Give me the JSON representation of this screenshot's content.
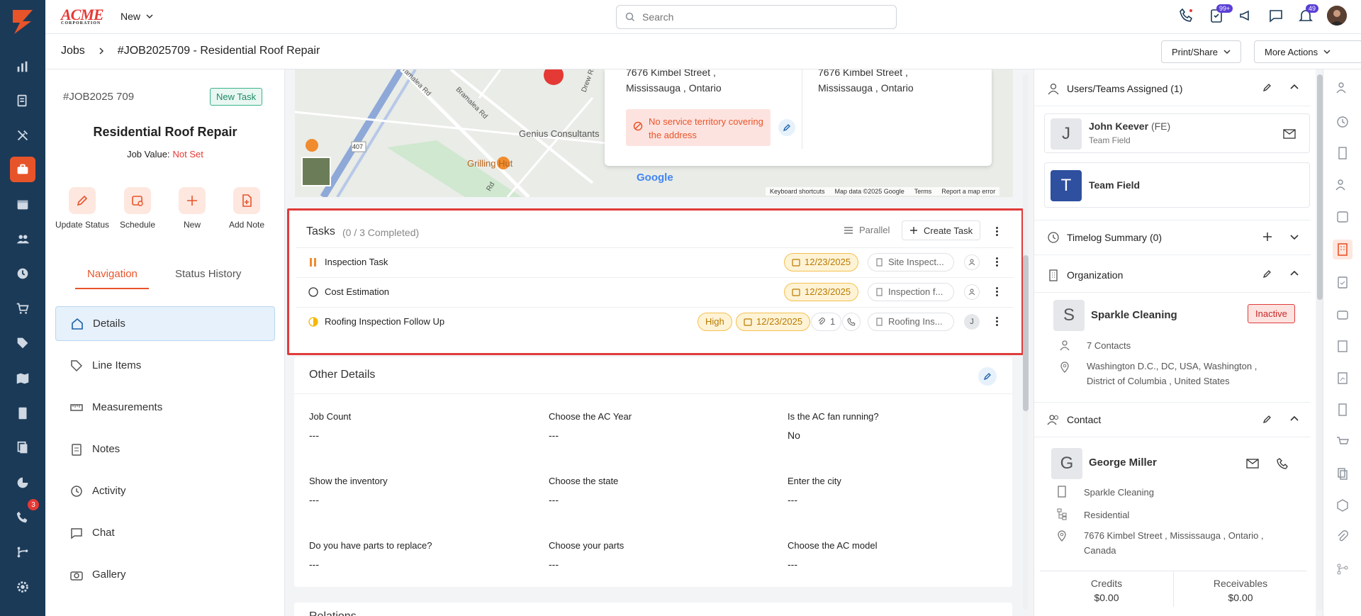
{
  "brand": {
    "name": "ACME",
    "sub": "CORPORATION"
  },
  "topbar": {
    "new_label": "New",
    "search_placeholder": "Search",
    "badges": {
      "tasks": "99+",
      "notifications": "49"
    }
  },
  "breadcrumb": {
    "root": "Jobs",
    "current": "#JOB2025709 - Residential Roof Repair"
  },
  "header_actions": {
    "print_share": "Print/Share",
    "more_actions": "More Actions"
  },
  "job": {
    "id": "#JOB2025 709",
    "status": "New Task",
    "title": "Residential Roof Repair",
    "value_label": "Job Value:",
    "value": "Not Set"
  },
  "quick_actions": [
    "Update Status",
    "Schedule",
    "New",
    "Add Note"
  ],
  "left_tabs": {
    "navigation": "Navigation",
    "status_history": "Status History"
  },
  "nav_items": [
    "Details",
    "Line Items",
    "Measurements",
    "Notes",
    "Activity",
    "Chat",
    "Gallery"
  ],
  "leftbar": {
    "calls_badge": "3"
  },
  "map": {
    "labels": [
      "Genius Consultants",
      "Grilling Hut",
      "Bramalea Rd",
      "Bramalea Rd",
      "407",
      "Drew Rd",
      "Rd",
      "Google",
      "Keyboard shortcuts",
      "Map data ©2025 Google",
      "Terms",
      "Report a map error"
    ]
  },
  "address_card": {
    "left_line1": "7676 Kimbel Street ,",
    "left_line2": "Mississauga , Ontario",
    "warning": "No service territory covering the address",
    "right_line1": "7676 Kimbel Street ,",
    "right_line2": "Mississauga , Ontario"
  },
  "tasks": {
    "title": "Tasks",
    "progress": "(0 / 3 Completed)",
    "mode": "Parallel",
    "create": "Create Task",
    "rows": [
      {
        "name": "Inspection Task",
        "date": "12/23/2025",
        "ref": "Site Inspect...",
        "priority": "",
        "attachments": ""
      },
      {
        "name": "Cost Estimation",
        "date": "12/23/2025",
        "ref": "Inspection f...",
        "priority": "",
        "attachments": ""
      },
      {
        "name": "Roofing Inspection Follow Up",
        "date": "12/23/2025",
        "ref": "Roofing Ins...",
        "priority": "High",
        "attachments": "1",
        "assignee_initial": "J"
      }
    ]
  },
  "other_details": {
    "title": "Other Details",
    "fields": [
      {
        "label": "Job Count",
        "value": "---"
      },
      {
        "label": "Choose the AC Year",
        "value": "---"
      },
      {
        "label": "Is the AC fan running?",
        "value": "No"
      },
      {
        "label": "Show the inventory",
        "value": "---"
      },
      {
        "label": "Choose the state",
        "value": "---"
      },
      {
        "label": "Enter the city",
        "value": "---"
      },
      {
        "label": "Do you have parts to replace?",
        "value": "---"
      },
      {
        "label": "Choose your parts",
        "value": "---"
      },
      {
        "label": "Choose the AC model",
        "value": "---"
      }
    ]
  },
  "next_section_title": "Relations",
  "right_panel": {
    "users_title": "Users/Teams Assigned (1)",
    "user": {
      "initial": "J",
      "name": "John Keever",
      "tag": "(FE)",
      "team": "Team Field"
    },
    "team": {
      "initial": "T",
      "name": "Team Field"
    },
    "timelog_title": "Timelog Summary (0)",
    "org_title": "Organization",
    "org": {
      "initial": "S",
      "name": "Sparkle Cleaning",
      "status": "Inactive",
      "contacts": "7 Contacts",
      "address_line1": "Washington D.C., DC, USA, Washington ,",
      "address_line2": "District of Columbia , United States"
    },
    "contact_title": "Contact",
    "contact": {
      "initial": "G",
      "name": "George Miller",
      "company": "Sparkle Cleaning",
      "type": "Residential",
      "address_line1": "7676 Kimbel Street , Mississauga , Ontario ,",
      "address_line2": "Canada"
    },
    "credits_label": "Credits",
    "credits": "$0.00",
    "receivables_label": "Receivables",
    "receivables": "$0.00"
  },
  "colors": {
    "accent": "#e8542a",
    "sidebar": "#1b3a57",
    "highlight": "#e03b3b",
    "warning_bg": "#fde3df",
    "team_blue": "#2f4f9f"
  }
}
